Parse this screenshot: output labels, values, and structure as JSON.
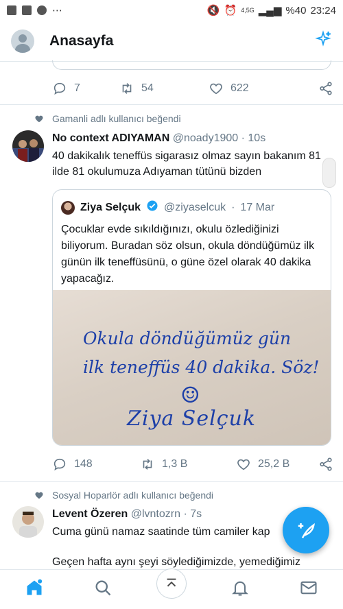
{
  "status_bar": {
    "network": "4,5G",
    "battery": "%40",
    "time": "23:24"
  },
  "header": {
    "title": "Anasayfa"
  },
  "prev_tweet": {
    "replies": "7",
    "retweets": "54",
    "likes": "622"
  },
  "tweet1": {
    "social_context": "Gamanli adlı kullanıcı beğendi",
    "name": "No context ADIYAMAN",
    "handle": "@noady1900",
    "sep": "·",
    "time": "10s",
    "text": "40 dakikalık teneffüs sigarasız olmaz sayın bakanım 81 ilde 81 okulumuza Adıyaman tütünü bizden",
    "quote": {
      "name": "Ziya Selçuk",
      "handle": "@ziyaselcuk",
      "sep": "·",
      "date": "17 Mar",
      "text": "Çocuklar evde sıkıldığınızı, okulu özlediğinizi biliyorum. Buradan söz olsun, okula döndüğümüz ilk günün ilk teneffüsünü, o güne özel olarak 40 dakika yapacağız.",
      "handwriting_line1": "Okula döndüğümüz gün",
      "handwriting_line2": "ilk teneffüs 40 dakika. Söz!",
      "handwriting_smiley": "☺",
      "signature": "Ziya Selçuk"
    },
    "replies": "148",
    "retweets": "1,3 B",
    "likes": "25,2 B"
  },
  "tweet2": {
    "social_context": "Sosyal Hoparlör adlı kullanıcı beğendi",
    "name": "Levent Özeren",
    "handle": "@lvntozrn",
    "sep": "·",
    "time": "7s",
    "text_line1": "Cuma günü namaz saatinde tüm camiler kap",
    "text_line2": "Geçen hafta aynı şeyi söylediğimizde, yemediğimiz"
  }
}
